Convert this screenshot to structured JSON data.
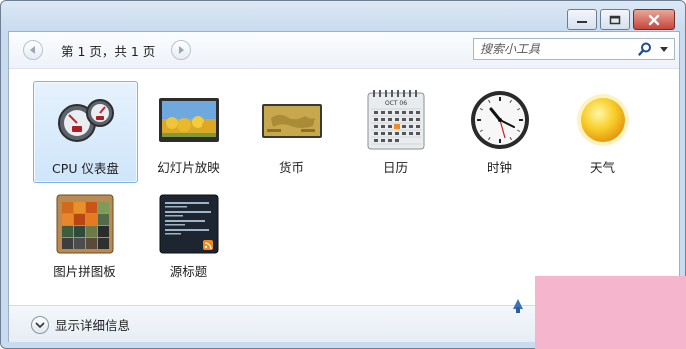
{
  "window": {
    "controls": {
      "minimize_icon": "minimize-icon",
      "maximize_icon": "maximize-icon",
      "close_icon": "close-icon"
    }
  },
  "nav": {
    "page_indicator": "第 1 页，共 1 页",
    "prev_icon": "arrow-left-icon",
    "next_icon": "arrow-right-icon"
  },
  "search": {
    "placeholder": "搜索小工具",
    "icon": "search-icon",
    "dropdown_icon": "chevron-down-icon"
  },
  "gadgets": [
    {
      "label": "CPU 仪表盘",
      "icon": "cpu-meter-icon",
      "selected": true
    },
    {
      "label": "幻灯片放映",
      "icon": "slideshow-icon",
      "selected": false
    },
    {
      "label": "货币",
      "icon": "currency-icon",
      "selected": false
    },
    {
      "label": "日历",
      "icon": "calendar-icon",
      "selected": false,
      "month_text": "OCT 06"
    },
    {
      "label": "时钟",
      "icon": "clock-icon",
      "selected": false
    },
    {
      "label": "天气",
      "icon": "weather-sun-icon",
      "selected": false
    },
    {
      "label": "图片拼图板",
      "icon": "picture-puzzle-icon",
      "selected": false
    },
    {
      "label": "源标题",
      "icon": "feed-headlines-icon",
      "selected": false
    }
  ],
  "footer": {
    "details_label": "显示详细信息",
    "details_icon": "chevron-down-circle-icon"
  },
  "colors": {
    "selection_bg": "#cfe5fb",
    "selection_border": "#7fb2e6",
    "overlay_pink": "#f5b5cc",
    "close_button_red": "#c6453b"
  }
}
